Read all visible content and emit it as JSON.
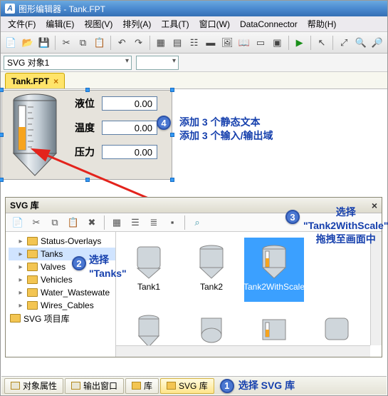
{
  "window": {
    "title": "图形编辑器 - Tank.FPT"
  },
  "menu": {
    "file": "文件(F)",
    "edit": "编辑(E)",
    "view": "视图(V)",
    "arrange": "排列(A)",
    "tools": "工具(T)",
    "window": "窗口(W)",
    "dataconnector": "DataConnector",
    "help": "帮助(H)"
  },
  "combo": {
    "object_label": "SVG 对象1",
    "percent": ""
  },
  "doc_tab": {
    "name": "Tank.FPT",
    "close": "×"
  },
  "form": {
    "rows": [
      {
        "label": "液位",
        "value": "0.00"
      },
      {
        "label": "温度",
        "value": "0.00"
      },
      {
        "label": "压力",
        "value": "0.00"
      }
    ]
  },
  "notes": {
    "n4_line1": "添加 3 个静态文本",
    "n4_line2": "添加 3 个输入/输出域",
    "n2_line1": "选择",
    "n2_line2": "\"Tanks\"",
    "n3_line1": "选择",
    "n3_line2": "\"Tank2WithScale\"",
    "n3_line3": "拖拽至画面中",
    "n1": "选择 SVG 库"
  },
  "lib": {
    "title": "SVG 库",
    "tree_root": "SVG 项目库",
    "folders": [
      "Status-Overlays",
      "Tanks",
      "Valves",
      "Vehicles",
      "Water_Wastewate",
      "Wires_Cables"
    ],
    "items_row1": [
      "Tank1",
      "Tank2",
      "Tank2WithScale"
    ],
    "items_row2": [
      "",
      "",
      "",
      ""
    ]
  },
  "bottom_tabs": {
    "t1": "对象属性",
    "t2": "输出窗口",
    "t3": "库",
    "t4": "SVG 库"
  }
}
